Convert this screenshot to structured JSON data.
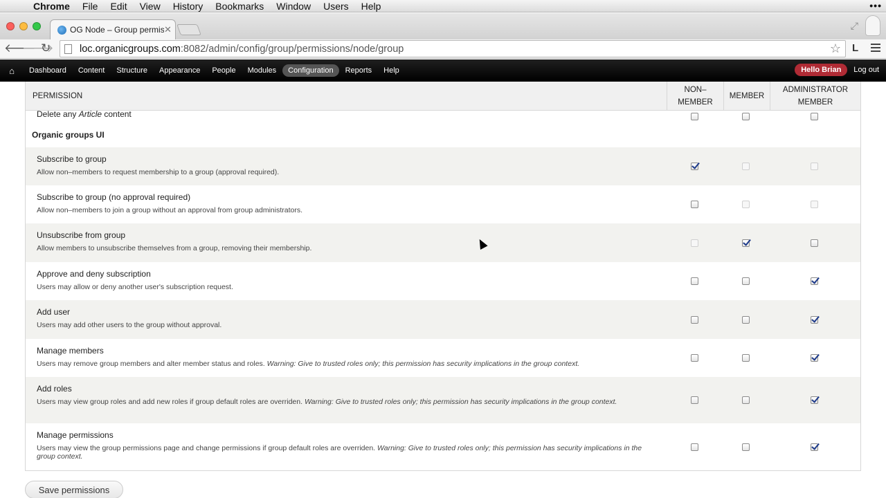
{
  "os_menubar": {
    "app": "Chrome",
    "items": [
      "File",
      "Edit",
      "View",
      "History",
      "Bookmarks",
      "Window",
      "Users",
      "Help"
    ]
  },
  "browser": {
    "tab_title": "OG Node – Group permissi",
    "url_host": "loc.organicgroups.com",
    "url_rest": ":8082/admin/config/group/permissions/node/group",
    "extension_label": "L"
  },
  "admin_bar": {
    "items": [
      "Dashboard",
      "Content",
      "Structure",
      "Appearance",
      "People",
      "Modules",
      "Configuration",
      "Reports",
      "Help"
    ],
    "active": "Configuration",
    "greeting": "Hello Brian",
    "logout": "Log out"
  },
  "table": {
    "headers": {
      "permission": "PERMISSION",
      "non_member": "NON–\nMEMBER",
      "member": "MEMBER",
      "administrator_member": "ADMINISTRATOR\nMEMBER"
    },
    "partial_row_title": "Delete any Article content",
    "group_heading": "Organic groups UI",
    "rows": [
      {
        "title": "Subscribe to group",
        "description": "Allow non–members to request membership to a group (approval required).",
        "warning": "",
        "states": [
          "checked",
          "disabled",
          "disabled"
        ]
      },
      {
        "title": "Subscribe to group (no approval required)",
        "description": "Allow non–members to join a group without an approval from group administrators.",
        "warning": "",
        "states": [
          "unchecked",
          "disabled",
          "disabled"
        ]
      },
      {
        "title": "Unsubscribe from group",
        "description": "Allow members to unsubscribe themselves from a group, removing their membership.",
        "warning": "",
        "states": [
          "disabled",
          "checked",
          "unchecked"
        ]
      },
      {
        "title": "Approve and deny subscription",
        "description": "Users may allow or deny another user's subscription request.",
        "warning": "",
        "states": [
          "unchecked",
          "unchecked",
          "checked"
        ]
      },
      {
        "title": "Add user",
        "description": "Users may add other users to the group without approval.",
        "warning": "",
        "states": [
          "unchecked",
          "unchecked",
          "checked"
        ]
      },
      {
        "title": "Manage members",
        "description": "Users may remove group members and alter member status and roles.",
        "warning": "Warning: Give to trusted roles only; this permission has security implications in the group context.",
        "states": [
          "unchecked",
          "unchecked",
          "checked"
        ]
      },
      {
        "title": "Add roles",
        "description": "Users may view group roles and add new roles if group default roles are overriden.",
        "warning": "Warning: Give to trusted roles only; this permission has security implications in the group context.",
        "states": [
          "unchecked",
          "unchecked",
          "checked"
        ]
      },
      {
        "title": "Manage permissions",
        "description": "Users may view the group permissions page and change permissions if group default roles are overriden.",
        "warning": "Warning: Give to trusted roles only; this permission has security implications in the group context.",
        "states": [
          "unchecked",
          "unchecked",
          "checked"
        ]
      }
    ]
  },
  "save_button": "Save permissions"
}
